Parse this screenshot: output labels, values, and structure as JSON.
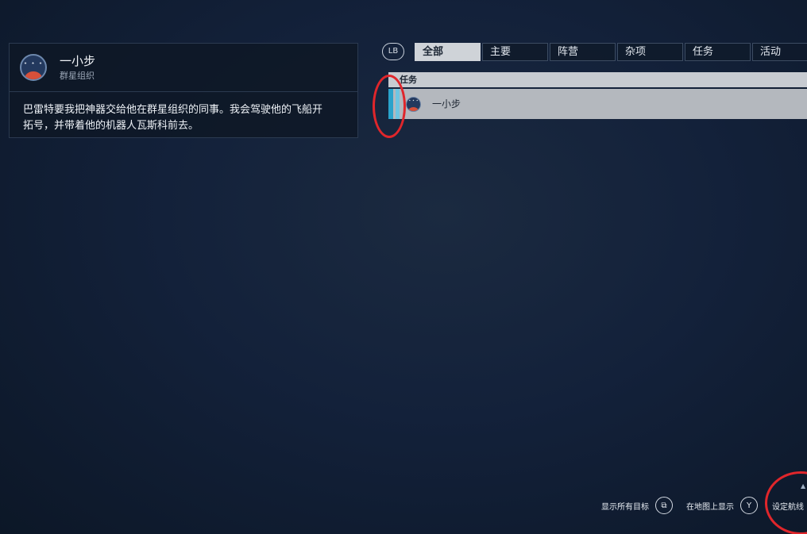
{
  "detail": {
    "title": "一小步",
    "faction": "群星组织",
    "description": "巴雷特要我把神器交给他在群星组织的同事。我会驾驶他的飞船开拓号，并带着他的机器人瓦斯科前去。",
    "emblem_stars": "⋆ ⋆ ⋆"
  },
  "tabs": {
    "lb_label": "LB",
    "items": [
      {
        "label": "全部",
        "active": true
      },
      {
        "label": "主要",
        "active": false
      },
      {
        "label": "阵营",
        "active": false
      },
      {
        "label": "杂项",
        "active": false
      },
      {
        "label": "任务",
        "active": false
      },
      {
        "label": "活动",
        "active": false
      }
    ]
  },
  "quest_list": {
    "category": "任务",
    "items": [
      {
        "name": "一小步",
        "selected": true
      }
    ]
  },
  "hints": [
    {
      "label": "显示所有目标",
      "key": "⧉"
    },
    {
      "label": "在地图上显示",
      "key": "Y"
    },
    {
      "label": "设定航线",
      "key": ""
    }
  ],
  "colors": {
    "background": "#13213a",
    "accent_cyan": "#2aa3cb",
    "annotation_red": "#e0262b",
    "tab_active": "#cfd3d8"
  }
}
